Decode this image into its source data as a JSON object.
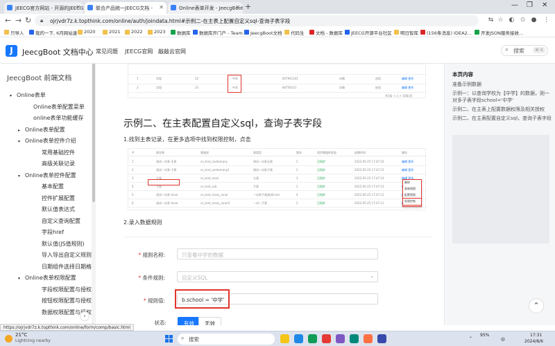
{
  "browser": {
    "tabs": [
      {
        "label": "JEECG官方网站 - 开源的JEECG",
        "active": false
      },
      {
        "label": "联合产品统一JEECG文档 - ",
        "active": true
      },
      {
        "label": "Online表单开发 - JeecgBoot 文",
        "active": false
      }
    ],
    "url": "ojrjvdr7z.k.topthink.com/online/auth/joindata.html#示例二-在主表上配置自定义sql-查询子表字段",
    "bookmarks": [
      "只导入",
      "我的一下, 6月网站速",
      "2020",
      "2021",
      "2022",
      "2023",
      "数据库",
      "数据库开门户 - Team...",
      "JeecgBoot文档",
      "代码生",
      "文档 - 数据库",
      "JEECG开源平台社区",
      "明日智库",
      "(156条消息) IDEA2...",
      "开发JSON服务接收..."
    ]
  },
  "site": {
    "title": "JeecgBoot 文档中心",
    "nav": [
      "常见问题",
      "JEECG官网",
      "敲敲云官网"
    ],
    "search_placeholder": "搜索",
    "search_shortcut": "⌘ K"
  },
  "sidebar": {
    "title": "JeecgBoot 前端文档",
    "items": [
      {
        "label": "Online表单",
        "arrow": "▾"
      },
      {
        "label": "Online表单配置菜单",
        "arrow": ""
      },
      {
        "label": "online表单功能缓存",
        "arrow": ""
      },
      {
        "label": "Online表单配置",
        "arrow": "▸"
      },
      {
        "label": "Online表单控件介绍",
        "arrow": "▾"
      },
      {
        "label": "常用基础控件",
        "arrow": ""
      },
      {
        "label": "高级关联记录",
        "arrow": ""
      },
      {
        "label": "Online表单控件配置",
        "arrow": "▾"
      },
      {
        "label": "基本配置",
        "arrow": ""
      },
      {
        "label": "控件扩展配置",
        "arrow": ""
      },
      {
        "label": "默认值表达式",
        "arrow": ""
      },
      {
        "label": "自定义查询配置",
        "arrow": ""
      },
      {
        "label": "字段href",
        "arrow": ""
      },
      {
        "label": "默认值(JS值规则)",
        "arrow": ""
      },
      {
        "label": "导入导出自定义规则",
        "arrow": ""
      },
      {
        "label": "日期组件选择日期格式",
        "arrow": ""
      },
      {
        "label": "Online表单权限配置",
        "arrow": "▾"
      },
      {
        "label": "字段权限配置与授权",
        "arrow": ""
      },
      {
        "label": "按钮权限配置与授权",
        "arrow": ""
      },
      {
        "label": "数据权限配置与授权",
        "arrow": ""
      }
    ],
    "collapse_symbol": "‹"
  },
  "content": {
    "section_title": "示例二、在主表配置自定义sql，查询子表字段",
    "step1": "1.找到主表记录，在更多选项中找到权限控制，点击",
    "step2": "2.录入数据规则",
    "form": {
      "rule_name_label": "规则名称:",
      "rule_name_placeholder": "只查看中学的数据",
      "condition_label": "条件规则:",
      "condition_value": "自定义SQL",
      "rule_value_label": "规则值:",
      "rule_value": "b.school = '中学'",
      "status_label": "状态:",
      "status_options": [
        "有效",
        "无效"
      ],
      "status_selected": "有效"
    },
    "screenshot_top_rows": [
      [
        "1",
        "字段",
        "22",
        "中学",
        "857941241",
        "详情",
        "启用",
        "编辑 更多"
      ],
      [
        "2",
        "字段",
        "23",
        "中学",
        "84759213",
        "详情",
        "启用",
        "编辑 更多"
      ]
    ],
    "screenshot_top_pager": "共2条  < 1 >  10条/页",
    "screenshot_header_cells": [
      "#",
      "表名称",
      "表描述",
      "表类型",
      "版本",
      "同步数据库状态",
      "创建时间",
      "操作"
    ],
    "screenshot_rows": [
      [
        "1",
        "测试一对多-主表",
        "ce_test_onetomany",
        "测试一对多主表",
        "2",
        "已同步",
        "2022-05-25 17:47:16"
      ],
      [
        "2",
        "测试一对多-子表",
        "ce_test_onetomany2",
        "测试一对多子表",
        "2",
        "已同步",
        "2022-05-25 17:47:15"
      ],
      [
        "3",
        "主表",
        "ce_test_main",
        "主表",
        "3",
        "已同步",
        "2022-05-25 17:47:14"
      ],
      [
        "4",
        "子表",
        "ce_test_sub",
        "子表",
        "2",
        "已同步",
        "2022-05-25 17:47:13"
      ],
      [
        "5",
        "测试一对多-Inner",
        "ce_test_many_inner",
        "一对多子表测试Inner",
        "4",
        "已同步",
        "2022-05-25 17:47:12"
      ],
      [
        "6",
        "测试一对多-Inner",
        "ce_test_many_inner2",
        "一对一子表",
        "2",
        "已同步",
        "2022-05-25 17:47:11"
      ]
    ],
    "screenshot_ops": "编辑  更多",
    "screenshot_menu": [
      "删除",
      "复制视图",
      "配置视图",
      "权限控制"
    ]
  },
  "toc": {
    "title": "本页内容",
    "items": [
      "准备示例数据",
      "示例一：以查询学校为【中学】的数据，则一对多子表字段school='中学'",
      "示例二、在主表上配置数据权限及相关授权",
      "示例二、在主表配置自定义sql，查询子表字段"
    ]
  },
  "status_url": "https://ojrjvdr7z.k.topthink.com/online/form/comp/basic.html",
  "taskbar": {
    "temp": "21°C",
    "weather": "Lightning nearby",
    "search_placeholder": "搜索",
    "battery": "95%",
    "lang": "中",
    "time": "17:31",
    "date": "2024/8/6"
  },
  "colors": {
    "accent": "#1677ff",
    "highlight": "#e0322b",
    "rail_bg": "#f5f6f8"
  }
}
